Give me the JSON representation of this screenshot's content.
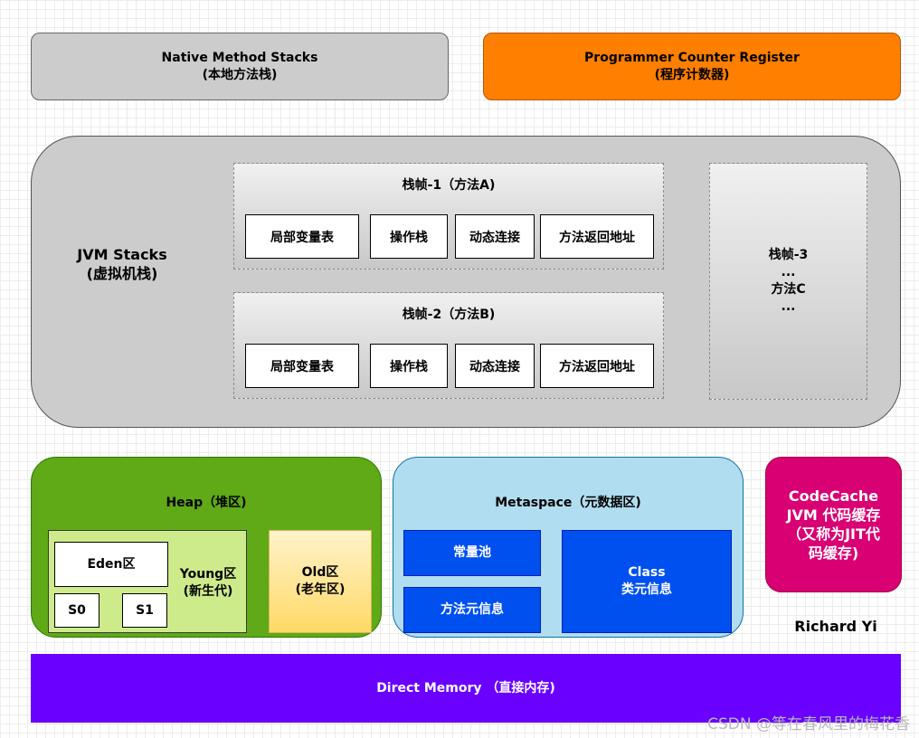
{
  "native_method_stacks": {
    "title": "Native Method Stacks",
    "subtitle": "(本地方法栈)"
  },
  "program_counter": {
    "title": "Programmer Counter Register",
    "subtitle": "(程序计数器)"
  },
  "jvm_stacks": {
    "title": "JVM Stacks",
    "subtitle": "(虚拟机栈)",
    "frames": [
      {
        "title": "栈帧-1（方法A)",
        "cells": [
          "局部变量表",
          "操作栈",
          "动态连接",
          "方法返回地址"
        ]
      },
      {
        "title": "栈帧-2（方法B)",
        "cells": [
          "局部变量表",
          "操作栈",
          "动态连接",
          "方法返回地址"
        ]
      }
    ],
    "frame3": {
      "lines": [
        "栈帧-3",
        "...",
        "方法C",
        "..."
      ]
    }
  },
  "heap": {
    "title": "Heap（堆区)",
    "young": {
      "label_line1": "Young区",
      "label_line2": "(新生代)",
      "eden": "Eden区",
      "s0": "S0",
      "s1": "S1"
    },
    "old": {
      "line1": "Old区",
      "line2": "(老年区)"
    }
  },
  "metaspace": {
    "title": "Metaspace（元数据区)",
    "constant_pool": "常量池",
    "method_info": "方法元信息",
    "class_line1": "Class",
    "class_line2": "类元信息"
  },
  "codecache": {
    "lines": [
      "CodeCache",
      "JVM 代码缓存",
      "（又称为JIT代",
      "码缓存)"
    ]
  },
  "author": "Richard Yi",
  "direct_memory": "Direct Memory （直接内存)",
  "watermark": "CSDN @等在春风里的梅花香"
}
